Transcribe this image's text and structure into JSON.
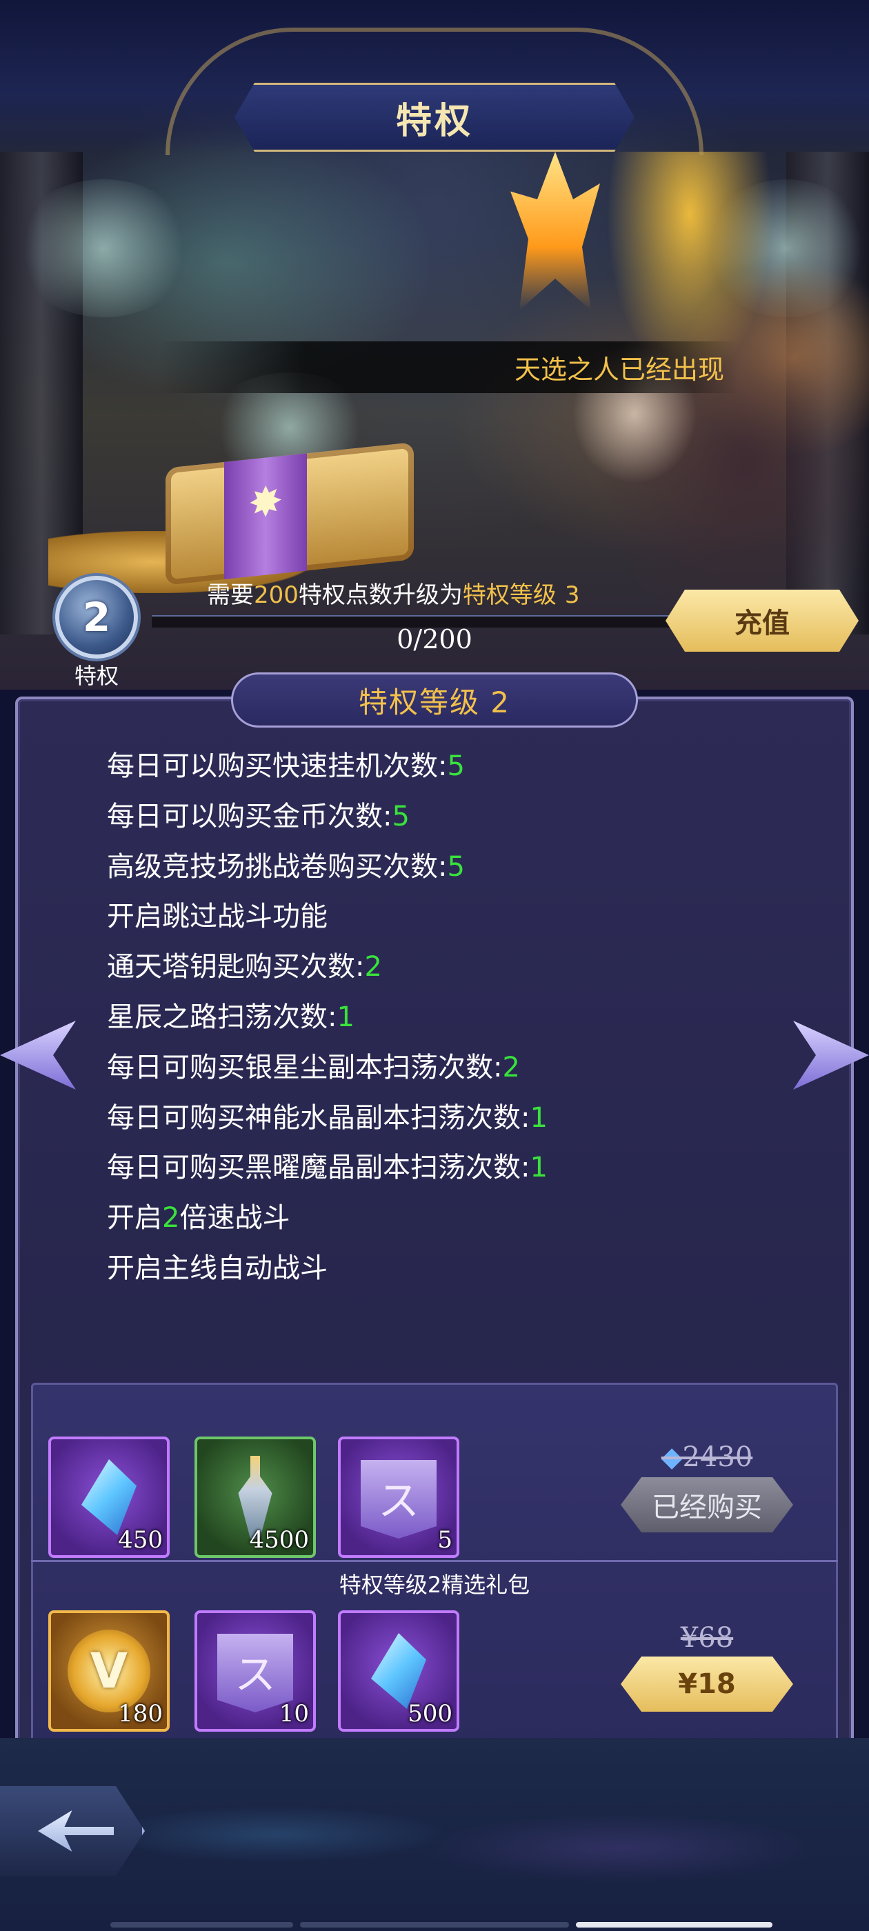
{
  "header": {
    "title": "特权"
  },
  "banner": {
    "text": "天选之人已经出现"
  },
  "vip": {
    "level": "2",
    "label": "特权",
    "upgrade_prefix": "需要",
    "upgrade_points": "200",
    "upgrade_middle": "特权点数升级为",
    "upgrade_target": "特权等级",
    "upgrade_target_level": "3",
    "progress_text": "0/200",
    "progress_fraction": 0,
    "recharge_label": "充值"
  },
  "panel": {
    "title": "特权等级 2",
    "benefits": [
      {
        "text": "每日可以购买快速挂机次数:",
        "num": "5",
        "tail": ""
      },
      {
        "text": "每日可以购买金币次数:",
        "num": "5",
        "tail": ""
      },
      {
        "text": "高级竞技场挑战卷购买次数:",
        "num": "5",
        "tail": ""
      },
      {
        "text": "开启跳过战斗功能",
        "num": "",
        "tail": ""
      },
      {
        "text": "通天塔钥匙购买次数:",
        "num": "2",
        "tail": ""
      },
      {
        "text": "星辰之路扫荡次数:",
        "num": "1",
        "tail": ""
      },
      {
        "text": "每日可购买银星尘副本扫荡次数:",
        "num": "2",
        "tail": ""
      },
      {
        "text": "每日可购买神能水晶副本扫荡次数:",
        "num": "1",
        "tail": ""
      },
      {
        "text": "每日可购买黑曜魔晶副本扫荡次数:",
        "num": "1",
        "tail": ""
      },
      {
        "text": "开启",
        "num": "2",
        "tail": "倍速战斗"
      },
      {
        "text": "开启主线自动战斗",
        "num": "",
        "tail": ""
      }
    ]
  },
  "package1": {
    "items": [
      {
        "icon": "blue-crystal-icon",
        "count": "450"
      },
      {
        "icon": "potion-icon",
        "count": "4500"
      },
      {
        "icon": "purple-scroll-icon",
        "count": "5"
      }
    ],
    "old_price": "2430",
    "button_label": "已经购买"
  },
  "package2": {
    "title": "特权等级2精选礼包",
    "items": [
      {
        "icon": "vip-medal-icon",
        "count": "180"
      },
      {
        "icon": "purple-scroll-icon",
        "count": "10"
      },
      {
        "icon": "blue-crystal-icon",
        "count": "500"
      }
    ],
    "old_price": "¥68",
    "button_label": "¥18"
  },
  "colors": {
    "gold": "#f2c14b",
    "green_number": "#39e23c",
    "panel": "#2d2b56"
  }
}
